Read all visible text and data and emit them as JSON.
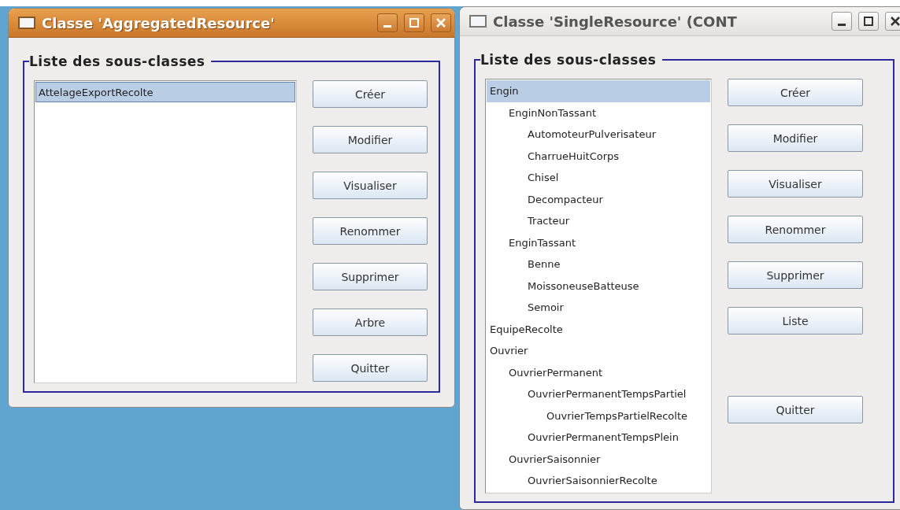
{
  "windows": [
    {
      "title": "Classe 'AggregatedResource'",
      "active": true,
      "group_title": "Liste des sous-classes",
      "list": [
        {
          "label": "AttelageExportRecolte",
          "selected": true
        }
      ],
      "buttons": [
        {
          "label": "Créer"
        },
        {
          "label": "Modifier"
        },
        {
          "label": "Visualiser"
        },
        {
          "label": "Renommer"
        },
        {
          "label": "Supprimer"
        },
        {
          "label": "Arbre"
        },
        {
          "label": "Quitter"
        }
      ]
    },
    {
      "title": "Classe 'SingleResource' (CONT",
      "active": false,
      "group_title": "Liste des sous-classes",
      "list": [
        {
          "label": "Engin",
          "selected": true,
          "children": [
            {
              "label": "EnginNonTassant",
              "selected": false,
              "children": [
                {
                  "label": "AutomoteurPulverisateur",
                  "selected": false
                },
                {
                  "label": "CharrueHuitCorps",
                  "selected": false
                },
                {
                  "label": "Chisel",
                  "selected": false
                },
                {
                  "label": "Decompacteur",
                  "selected": false
                },
                {
                  "label": "Tracteur",
                  "selected": false
                }
              ]
            },
            {
              "label": "EnginTassant",
              "selected": false,
              "children": [
                {
                  "label": "Benne",
                  "selected": false
                },
                {
                  "label": "MoissoneuseBatteuse",
                  "selected": false
                },
                {
                  "label": "Semoir",
                  "selected": false
                }
              ]
            }
          ]
        },
        {
          "label": "EquipeRecolte",
          "selected": false
        },
        {
          "label": "Ouvrier",
          "selected": false,
          "children": [
            {
              "label": "OuvrierPermanent",
              "selected": false,
              "children": [
                {
                  "label": "OuvrierPermanentTempsPartiel",
                  "selected": false,
                  "children": [
                    {
                      "label": "OuvrierTempsPartielRecolte",
                      "selected": false
                    }
                  ]
                },
                {
                  "label": "OuvrierPermanentTempsPlein",
                  "selected": false
                }
              ]
            },
            {
              "label": "OuvrierSaisonnier",
              "selected": false,
              "children": [
                {
                  "label": "OuvrierSaisonnierRecolte",
                  "selected": false
                }
              ]
            }
          ]
        }
      ],
      "buttons": [
        {
          "label": "Créer"
        },
        {
          "label": "Modifier"
        },
        {
          "label": "Visualiser"
        },
        {
          "label": "Renommer"
        },
        {
          "label": "Supprimer"
        },
        {
          "label": "Liste"
        },
        {
          "label": "Quitter"
        }
      ]
    }
  ]
}
